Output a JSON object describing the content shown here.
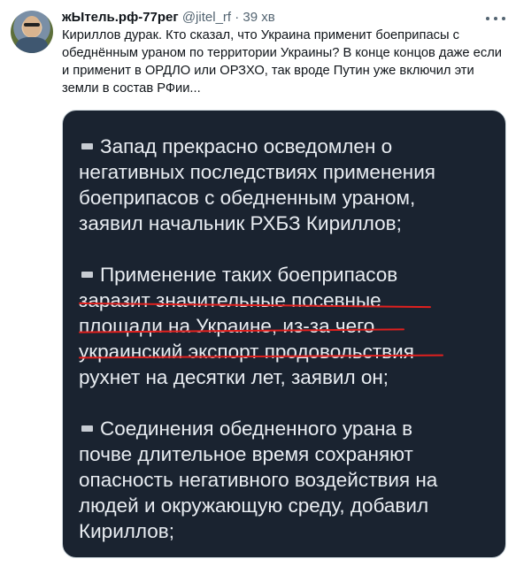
{
  "header": {
    "display_name": "жЫтель.рф-77рег",
    "handle": "@jitel_rf",
    "separator": "·",
    "time": "39 хв"
  },
  "tweet": {
    "text": "Кириллов дурак. Кто сказал, что Украина применит боеприпасы с обеднённым ураном по территории Украины? В конце концов даже если и применит в ОРДЛО или ОРЗХО, так вроде Путин уже включил эти земли в состав РФии..."
  },
  "media": {
    "paragraphs": [
      {
        "lines": [
          "Запад прекрасно осведомлен о",
          "негативных последствиях применения",
          "боеприпасов с обедненным ураном,",
          "заявил начальник РХБЗ Кириллов;"
        ]
      },
      {
        "lines": [
          "Применение таких боеприпасов",
          "заразит значительные посевные",
          "площади на Украине, из-за чего",
          "украинский экспорт продовольствия",
          "рухнет на десятки лет, заявил он;"
        ]
      },
      {
        "lines": [
          "Соединения обедненного урана в",
          "почве длительное время сохраняют",
          "опасность негативного воздействия на",
          "людей и окружающую среду, добавил",
          "Кириллов;"
        ]
      }
    ],
    "bullet_icon": "black-square-icon",
    "underline_color": "#e0201e",
    "background_color": "#1a2330"
  }
}
